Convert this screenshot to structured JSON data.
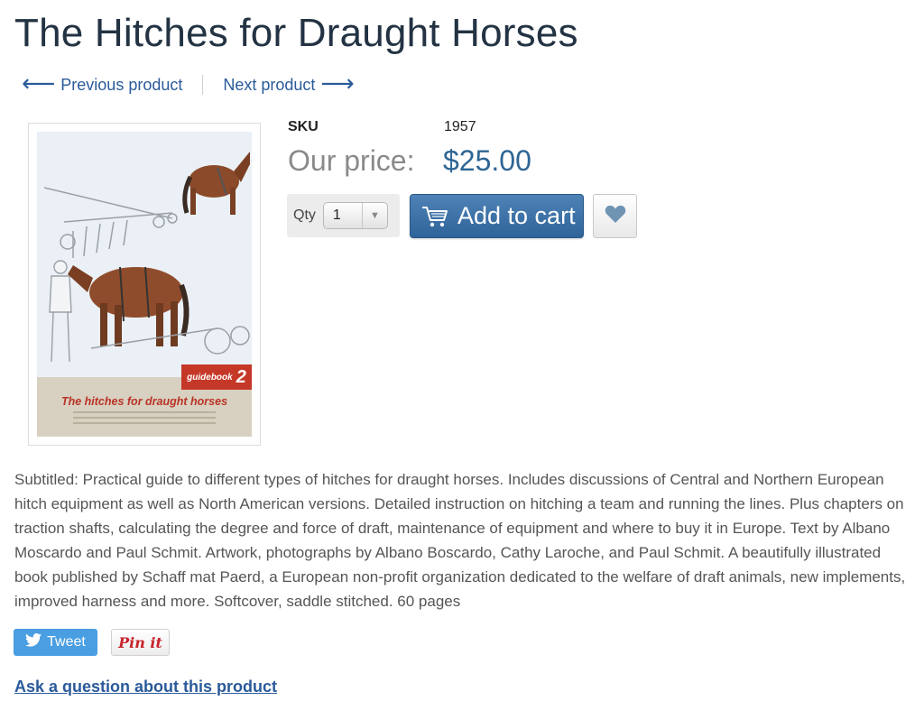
{
  "product": {
    "title": "The Hitches for Draught Horses",
    "sku_label": "SKU",
    "sku_value": "1957",
    "price_label": "Our price:",
    "price_value": "$25.00",
    "description": "Subtitled: Practical guide to different types of hitches for draught horses. Includes discussions of Central and Northern European hitch equipment as well as North American versions. Detailed instruction on hitching a team and running the lines. Plus chapters on traction shafts, calculating the degree and force of draft, maintenance of equipment and where to buy it in Europe. Text by Albano Moscardo and Paul Schmit. Artwork, photographs by Albano Boscardo, Cathy Laroche, and Paul Schmit. A beautifully illustrated book published by Schaff mat Paerd, a European non-profit organization dedicated to the welfare of draft animals, new implements, improved harness and more. Softcover, saddle stitched. 60 pages"
  },
  "nav": {
    "previous_label": "Previous product",
    "next_label": "Next product",
    "previous_arrow": "⟵",
    "next_arrow": "⟶"
  },
  "cover": {
    "badge_text": "guidebook",
    "badge_number": "2",
    "cover_title": "The hitches for draught horses"
  },
  "purchase": {
    "qty_label": "Qty",
    "qty_value": "1",
    "add_to_cart_label": "Add to cart",
    "cart_icon": "cart-icon",
    "wishlist_icon": "heart-icon"
  },
  "social": {
    "tweet_label": "Tweet",
    "pin_label": "Pin it"
  },
  "links": {
    "ask_question": "Ask a question about this product"
  },
  "colors": {
    "accent": "#2e6594",
    "link": "#2a5a9a",
    "tweet": "#4a9ee2",
    "pinterest": "#c8232c"
  }
}
